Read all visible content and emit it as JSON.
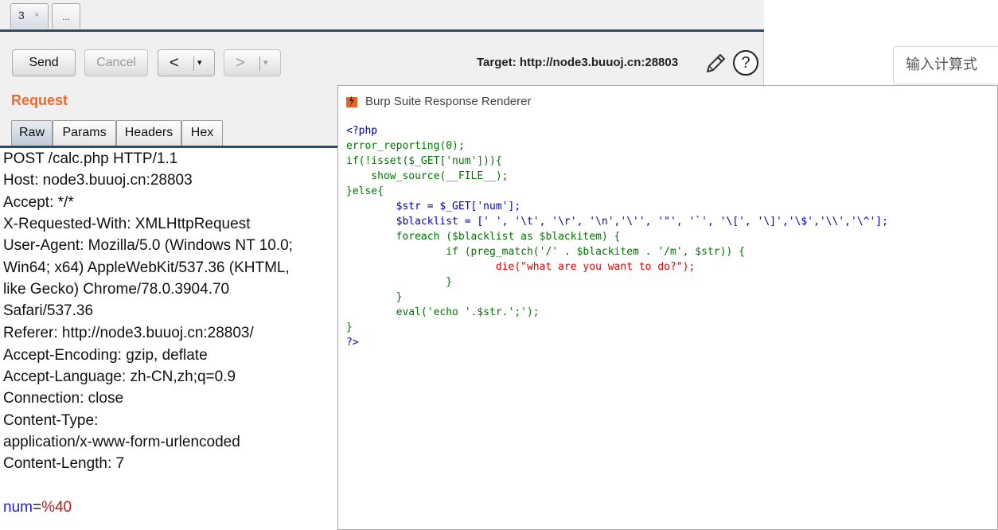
{
  "repeater": {
    "tabs": [
      {
        "label": "3",
        "close": "×"
      },
      {
        "label": "..."
      }
    ],
    "toolbar": {
      "send_label": "Send",
      "cancel_label": "Cancel",
      "back_arrow": "<",
      "forward_arrow": ">",
      "dropdown_glyph": "▾",
      "target_text": "Target: http://node3.buuoj.cn:28803",
      "help_glyph": "?"
    },
    "request": {
      "heading": "Request",
      "tabs": [
        "Raw",
        "Params",
        "Headers",
        "Hex"
      ],
      "raw_lines": [
        "POST /calc.php HTTP/1.1",
        "Host: node3.buuoj.cn:28803",
        "Accept: */*",
        "X-Requested-With: XMLHttpRequest",
        "User-Agent: Mozilla/5.0 (Windows NT 10.0;",
        "Win64; x64) AppleWebKit/537.36 (KHTML,",
        "like Gecko) Chrome/78.0.3904.70",
        "Safari/537.36",
        "Referer: http://node3.buuoj.cn:28803/",
        "Accept-Encoding: gzip, deflate",
        "Accept-Language: zh-CN,zh;q=0.9",
        "Connection: close",
        "Content-Type:",
        "application/x-www-form-urlencoded",
        "Content-Length: 7"
      ],
      "body_param_name": "num",
      "body_param_eq": "=",
      "body_param_value": "%40"
    }
  },
  "page": {
    "calc_input_placeholder": "输入计算式"
  },
  "renderer": {
    "title": "Burp Suite Response Renderer",
    "code_lines": [
      "<?php",
      "error_reporting(0);",
      "if(!isset($_GET['num'])){",
      "    show_source(__FILE__);",
      "}else{",
      "        $str = $_GET['num'];",
      "        $blacklist = [' ', '\\t', '\\r', '\\n','\\'', '\"', '`', '\\[', '\\]','\\$','\\\\','\\^'];",
      "        foreach ($blacklist as $blackitem) {",
      "                if (preg_match('/' . $blackitem . '/m', $str)) {",
      "                        die(\"what are you want to do?\");",
      "                }",
      "        }",
      "        eval('echo '.$str.';');",
      "}",
      "?>"
    ]
  },
  "colors": {
    "accent_orange": "#ee6a2c",
    "tab_underline": "#2b4a6f",
    "php_html": "#0000bb",
    "php_keyword": "#007700",
    "php_string": "#dd0000",
    "param_name": "#1d1ddb",
    "param_value": "#c21818"
  },
  "icons": [
    "close-icon",
    "chevron-left-icon",
    "chevron-right-icon",
    "dropdown-icon",
    "pencil-icon",
    "help-icon",
    "burp-logo-icon"
  ]
}
